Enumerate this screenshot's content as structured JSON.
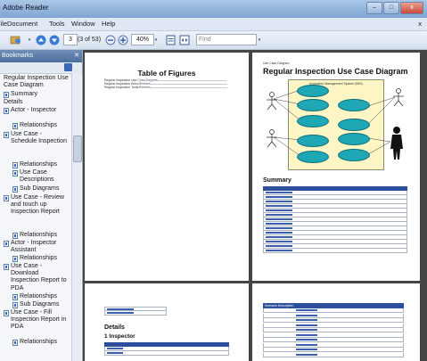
{
  "window": {
    "title": "Adobe Reader",
    "controls": [
      "–",
      "□",
      "x"
    ]
  },
  "menu": {
    "items": [
      "File",
      "Document",
      "Tools",
      "Window",
      "Help"
    ],
    "close": "x"
  },
  "toolbar": {
    "page_number": "3",
    "page_count": "(3 of 53)",
    "zoom": "40%",
    "find_placeholder": "Find"
  },
  "sidebar": {
    "title": "Bookmarks",
    "items": [
      {
        "label": "Regular Inspection Use Case Diagram",
        "icon": false
      },
      {
        "label": "Summary",
        "icon": true
      },
      {
        "label": "Details",
        "icon": false
      },
      {
        "label": "Actor - Inspector",
        "icon": true
      },
      {
        "label": "Relationships",
        "icon": true
      },
      {
        "label": "Use Case - Schedule Inspection",
        "icon": true
      },
      {
        "label": "Relationships",
        "icon": true
      },
      {
        "label": "Use Case Descriptions",
        "icon": true
      },
      {
        "label": "Sub Diagrams",
        "icon": true
      },
      {
        "label": "Use Case - Review and touch up Inspection Report",
        "icon": true
      },
      {
        "label": "Relationships",
        "icon": true
      },
      {
        "label": "Actor - Inspector Assistant",
        "icon": true
      },
      {
        "label": "Relationships",
        "icon": true
      },
      {
        "label": "Use Case - Download Inspection Report to PDA",
        "icon": true
      },
      {
        "label": "Relationships",
        "icon": true
      },
      {
        "label": "Sub Diagrams",
        "icon": true
      },
      {
        "label": "Use Case - Fill Inspection Report in PDA",
        "icon": true
      },
      {
        "label": "Relationships",
        "icon": true
      }
    ]
  },
  "pages": {
    "page1": {
      "title": "Table of Figures",
      "entries": [
        "Regular Inspection Use Case Diagram",
        "Regular Inspection Actor Process",
        "Regular Inspection Tools Process"
      ]
    },
    "page2": {
      "header": "Use Case Diagram",
      "title": "Regular Inspection Use Case Diagram",
      "system_label": "Inspection Management System (IMS)",
      "summary_heading": "Summary"
    },
    "page3": {
      "details_heading": "Details",
      "inspector_heading": "1 Inspector"
    },
    "page4": {
      "header": "Scenario Description"
    }
  }
}
